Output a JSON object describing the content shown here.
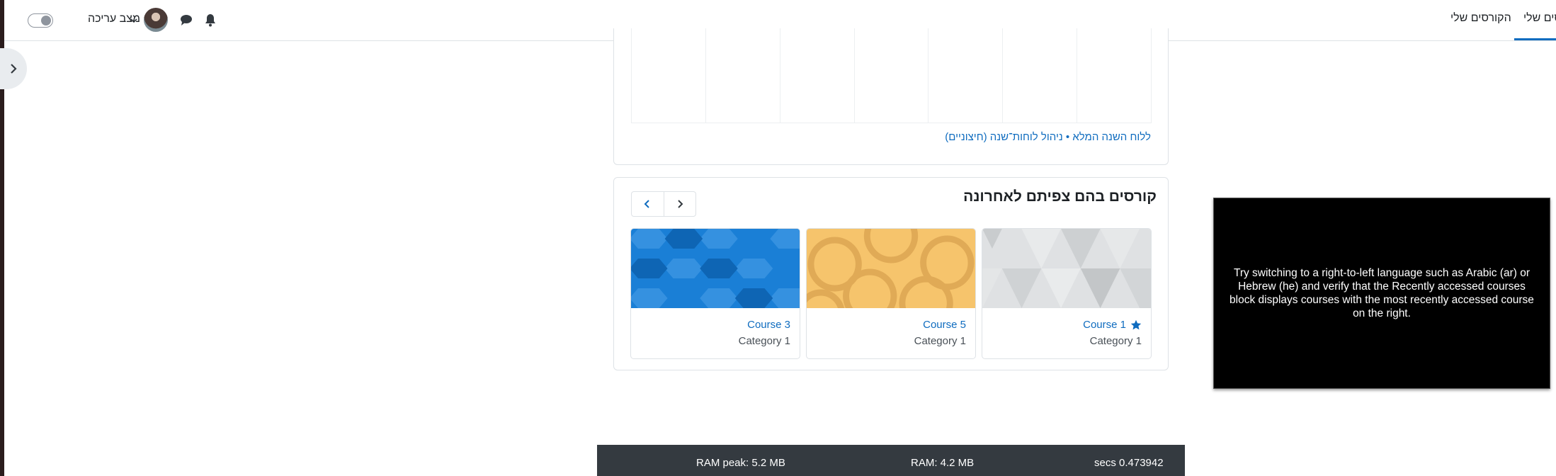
{
  "navbar": {
    "items": [
      {
        "label": "רסים שלי",
        "active": true
      },
      {
        "label": "הקורסים שלי",
        "active": false
      }
    ],
    "edit_mode_label": "מצב עריכה",
    "accent_color": "#0f6cbf"
  },
  "calendar_block": {
    "link_full_year": "ללוח השנה המלא",
    "separator": "•",
    "link_manage": "ניהול לוחות־שנה (חיצוניים)"
  },
  "recent_courses": {
    "title": "קורסים בהם צפיתם לאחרונה",
    "courses": [
      {
        "name": "Course 1",
        "category": "Category 1",
        "starred": true,
        "pattern": "grey-triangles"
      },
      {
        "name": "Course 5",
        "category": "Category 1",
        "starred": false,
        "pattern": "yellow-circles"
      },
      {
        "name": "Course 3",
        "category": "Category 1",
        "starred": false,
        "pattern": "blue-octagons"
      }
    ]
  },
  "overlay": {
    "text": "Try switching to a right-to-left language such as Arabic (ar) or Hebrew (he) and verify that the Recently accessed courses block displays courses with the most recently accessed course on the right."
  },
  "perf": {
    "secs": "secs 0.473942",
    "ram": "RAM: 4.2 MB",
    "ram_peak": "RAM peak: 5.2 MB"
  }
}
